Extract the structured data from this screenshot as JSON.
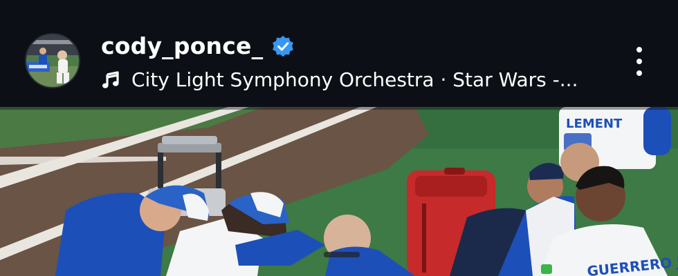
{
  "post_header": {
    "username": "cody_ponce_",
    "verified": true,
    "audio": "City Light Symphony Orchestra · Star Wars -...",
    "more_icon": "more-vertical-icon",
    "music_icon": "music-note-icon",
    "verified_icon": "verified-badge-icon"
  },
  "media": {
    "jersey_text_1": "GUERRERO JR",
    "jersey_text_2": "LEMENT"
  },
  "colors": {
    "background": "#0c1016",
    "verified_blue": "#3897f0",
    "jays_blue": "#1d4fb8"
  }
}
